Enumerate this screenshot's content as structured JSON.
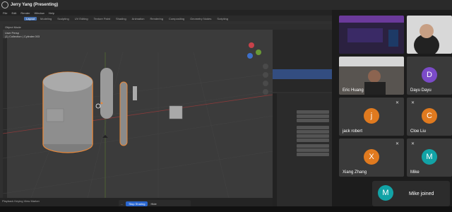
{
  "window": {
    "title": "Jerry Yang (Presenting)"
  },
  "blender": {
    "menu": [
      "File",
      "Edit",
      "Render",
      "Window",
      "Help"
    ],
    "tabs": [
      "Layout",
      "Modeling",
      "Sculpting",
      "UV Editing",
      "Texture Paint",
      "Shading",
      "Animation",
      "Rendering",
      "Compositing",
      "Geometry Nodes",
      "Scripting"
    ],
    "viewport_info": [
      "User Persp",
      "(1) Collection | Cylinder.003"
    ],
    "timeline_labels": [
      "Playback",
      "Keying",
      "View",
      "Marker"
    ]
  },
  "zoom": {
    "participants": [
      {
        "name": "Eric Huang",
        "type": "video"
      },
      {
        "name": "Dayu Dayu",
        "initial": "D",
        "color": "#7b4bc8"
      },
      {
        "name": "jack robert",
        "initial": "j",
        "color": "#e07a1f"
      },
      {
        "name": "Cloe Liu",
        "initial": "C",
        "color": "#e07a1f"
      },
      {
        "name": "Xiang Zhang",
        "initial": "X",
        "color": "#e07a1f"
      },
      {
        "name": "Mike",
        "initial": "M",
        "color": "#12a3a6"
      }
    ],
    "share_bar": {
      "text": "...",
      "stop": "Stop Sharing",
      "hide": "Hide"
    },
    "toast": {
      "initial": "M",
      "message": "Mike joined"
    }
  }
}
